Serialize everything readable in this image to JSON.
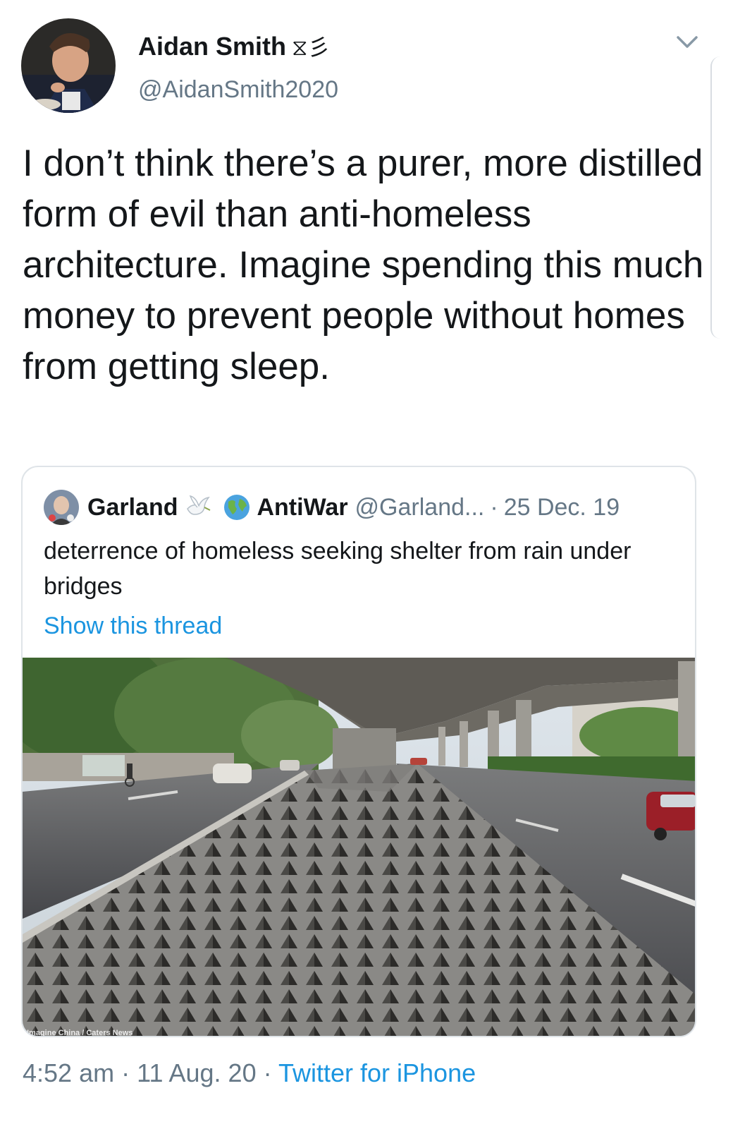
{
  "author": {
    "name": "Aidan Smith",
    "badge": "⧖彡",
    "handle": "@AidanSmith2020"
  },
  "tweet": {
    "text": "I don’t think there’s a purer, more distilled form of evil than anti-homeless architecture. Imagine spending this much money to prevent people without homes from getting sleep."
  },
  "quote": {
    "name": "Garland",
    "name2": "AntiWar",
    "handle": "@Garland...",
    "separator": "·",
    "date": "25 Dec. 19",
    "text": "deterrence of homeless seeking shelter from rain under bridges",
    "thread_link": "Show this thread",
    "photo_credit": "Imagine China / Caters News"
  },
  "footer": {
    "time": "4:52 am",
    "separator": "·",
    "date": "11 Aug. 20",
    "source": "Twitter for iPhone"
  },
  "icons": {
    "menu": "chevron-down-icon",
    "emoji1": "dove-icon",
    "emoji2": "globe-icon"
  },
  "colors": {
    "text": "#14171a",
    "secondary": "#657786",
    "link": "#1b95e0",
    "border": "#dfe4e8"
  }
}
